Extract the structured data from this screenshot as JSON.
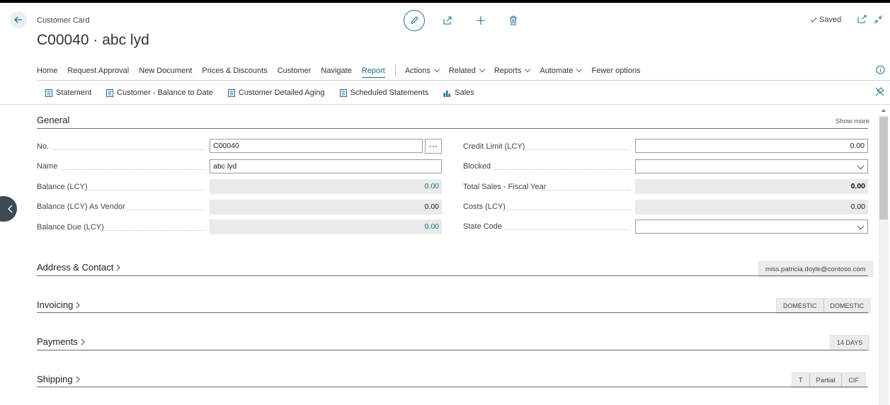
{
  "header": {
    "kicker": "Customer Card",
    "title": "C00040 · abc lyd",
    "saved_label": "Saved"
  },
  "action_bar": {
    "items": [
      "Home",
      "Request Approval",
      "New Document",
      "Prices & Discounts",
      "Customer",
      "Navigate",
      "Report"
    ],
    "active": "Report",
    "dropdowns": [
      "Actions",
      "Related",
      "Reports",
      "Automate"
    ],
    "fewer_options": "Fewer options"
  },
  "report_bar": {
    "items": [
      {
        "label": "Statement",
        "icon": "report-icon"
      },
      {
        "label": "Customer - Balance to Date",
        "icon": "report-icon"
      },
      {
        "label": "Customer Detailed Aging",
        "icon": "report-icon"
      },
      {
        "label": "Scheduled Statements",
        "icon": "report-icon"
      },
      {
        "label": "Sales",
        "icon": "sales-chart-icon"
      }
    ]
  },
  "general": {
    "title": "General",
    "show_more": "Show more",
    "left": [
      {
        "label": "No.",
        "value": "C00040"
      },
      {
        "label": "Name",
        "value": "abc lyd"
      },
      {
        "label": "Balance (LCY)",
        "value": "0.00"
      },
      {
        "label": "Balance (LCY) As Vendor",
        "value": "0.00"
      },
      {
        "label": "Balance Due (LCY)",
        "value": "0.00"
      }
    ],
    "right": [
      {
        "label": "Credit Limit (LCY)",
        "value": "0.00"
      },
      {
        "label": "Blocked",
        "value": ""
      },
      {
        "label": "Total Sales - Fiscal Year",
        "value": "0.00"
      },
      {
        "label": "Costs (LCY)",
        "value": "0.00"
      },
      {
        "label": "State Code",
        "value": ""
      }
    ]
  },
  "sections": {
    "address": {
      "title": "Address & Contact",
      "summary": [
        "miss.patricia.doyle@contoso.com"
      ]
    },
    "invoicing": {
      "title": "Invoicing",
      "summary": [
        "DOMESTIC",
        "DOMESTIC"
      ]
    },
    "payments": {
      "title": "Payments",
      "summary": [
        "14 DAYS"
      ]
    },
    "shipping": {
      "title": "Shipping",
      "summary": [
        "T",
        "Partial",
        "CIF"
      ]
    }
  },
  "colors": {
    "accent": "#1a6e8a",
    "readonly_bg": "#eaeaea",
    "collapse_btn": "#3f4a55"
  }
}
